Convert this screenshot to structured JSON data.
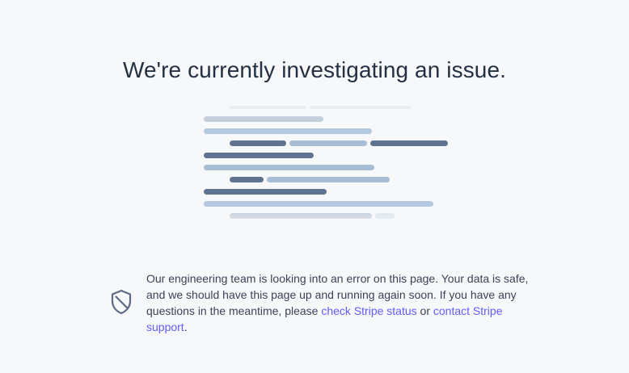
{
  "page": {
    "title": "We're currently investigating an issue.",
    "illustration_icon": "code-lines-illustration",
    "notice": {
      "icon": "shield-slash-icon",
      "text_before": "Our engineering team is looking into an error on this page. Your data is safe, and we should have this page up and running again soon. If you have any questions in the meantime, please ",
      "status_link": "check Stripe status",
      "text_between": " or ",
      "support_link": "contact Stripe support",
      "text_after": "."
    }
  },
  "colors": {
    "background": "#f6f8fa",
    "heading": "#243043",
    "body_text": "#3c4257",
    "link": "#635bff",
    "icon": "#5f6b85",
    "line_dark": "#5a6f8c",
    "line_medium": "#a7bdd6",
    "line_light": "#c8d3df"
  }
}
